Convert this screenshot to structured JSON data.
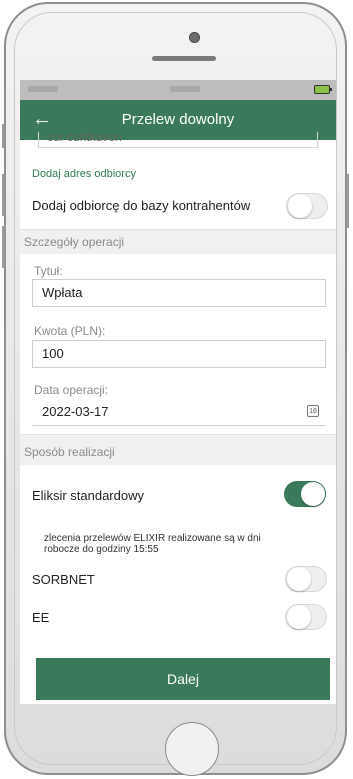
{
  "header": {
    "title": "Przelew dowolny",
    "back_icon": "arrow-left-icon"
  },
  "recipient": {
    "cut_field_value": "cur cuntkuvon",
    "add_address_link": "Dodaj adres odbiorcy",
    "add_to_contacts_label": "Dodaj odbiorcę do bazy kontrahentów",
    "add_to_contacts_on": false
  },
  "details": {
    "section_title": "Szczegóły operacji",
    "title_label": "Tytuł:",
    "title_value": "Wpłata",
    "amount_label": "Kwota (PLN):",
    "amount_value": "100",
    "date_label": "Data operacji:",
    "date_value": "2022-03-17",
    "calendar_badge": "16"
  },
  "execution": {
    "section_title": "Sposób realizacji",
    "options": [
      {
        "label": "Eliksir standardowy",
        "on": true
      },
      {
        "label": "SORBNET",
        "on": false
      },
      {
        "label": "EE",
        "on": false
      }
    ],
    "info_text": "zlecenia przelewów ELIXIR realizowane są w dni robocze do godziny 15:55"
  },
  "footer": {
    "next_button": "Dalej"
  },
  "colors": {
    "brand_green": "#3a7a5b",
    "section_bg": "#f0f0f0"
  }
}
